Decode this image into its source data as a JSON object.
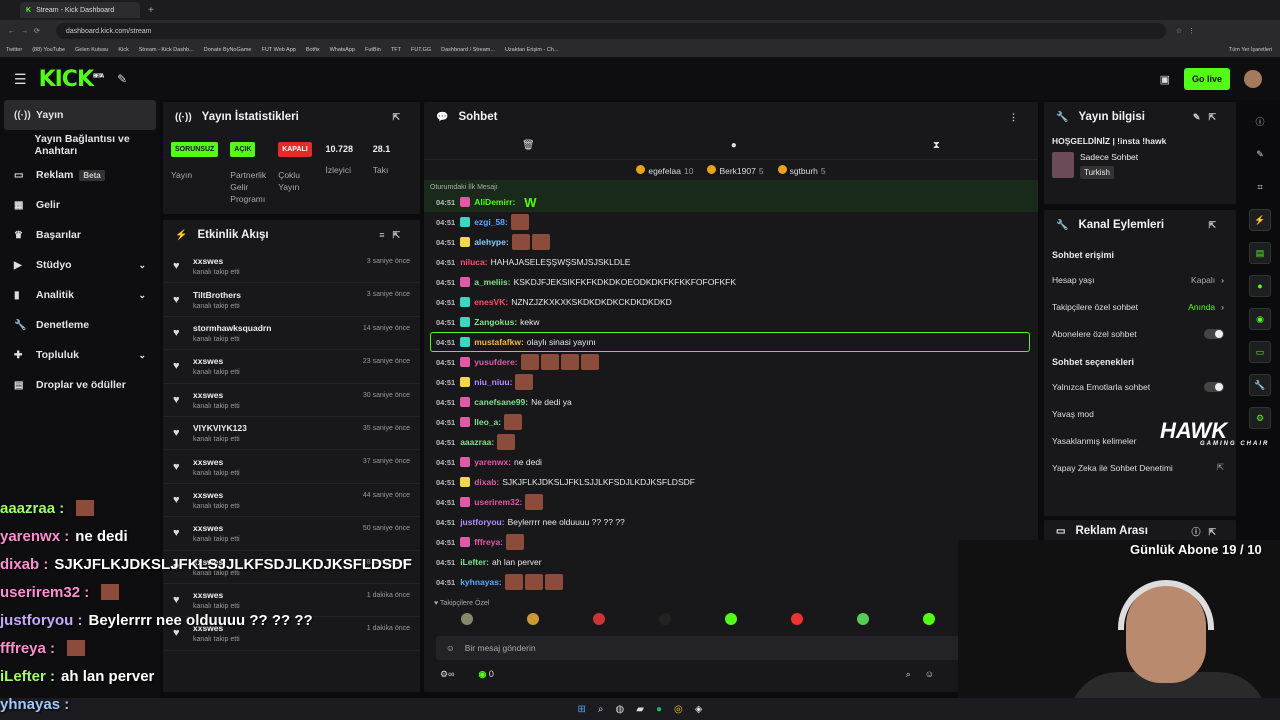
{
  "browser": {
    "tab_title": "Stream - Kick Dashboard",
    "url": "dashboard.kick.com/stream",
    "bookmarks": [
      "Twitter",
      "(88) YouTube",
      "Gelen Kutusu",
      "Kick",
      "Stream - Kick Dashb...",
      "Donate ByNoGame",
      "FUT Web App",
      "Botfix",
      "WhatsApp",
      "FutBin",
      "TFT",
      "FUT.GG",
      "Dashboard / Stream...",
      "Uzaktan Erişim - Ch..."
    ],
    "bookmarks_right": "Tüm Yer İşaretleri"
  },
  "header": {
    "logo": "KICK",
    "logo_sup": "BETA",
    "go_live": "Go live"
  },
  "sidebar": {
    "items": [
      {
        "label": "Yayın",
        "icon": "broadcast-icon"
      },
      {
        "label": "Yayın Bağlantısı ve Anahtarı",
        "icon": ""
      },
      {
        "label": "Reklam",
        "icon": "tv-icon",
        "badge": "Beta"
      },
      {
        "label": "Gelir",
        "icon": "grid-icon"
      },
      {
        "label": "Başarılar",
        "icon": "trophy-icon"
      },
      {
        "label": "Stüdyo",
        "icon": "video-icon"
      },
      {
        "label": "Analitik",
        "icon": "chart-icon"
      },
      {
        "label": "Denetleme",
        "icon": "wrench-icon"
      },
      {
        "label": "Topluluk",
        "icon": "community-icon"
      },
      {
        "label": "Droplar ve ödüller",
        "icon": "gift-icon"
      }
    ]
  },
  "stats": {
    "title": "Yayın İstatistikleri",
    "items": [
      {
        "badge": "SORUNSUZ",
        "label": "Yayın"
      },
      {
        "badge": "AÇIK",
        "label": "Partnerlik Gelir Programı"
      },
      {
        "badge": "KAPALI",
        "label": "Çoklu Yayın"
      },
      {
        "value": "10.728",
        "label": "İzleyici"
      },
      {
        "value": "28.1",
        "label": "Takı"
      }
    ]
  },
  "activity": {
    "title": "Etkinlik Akışı",
    "items": [
      {
        "name": "xxswes",
        "action": "kanalı takip etti",
        "time": "3 saniye önce"
      },
      {
        "name": "TiltBrothers",
        "action": "kanalı takip etti",
        "time": "3 saniye önce"
      },
      {
        "name": "stormhawksquadrn",
        "action": "kanalı takip etti",
        "time": "14 saniye önce"
      },
      {
        "name": "xxswes",
        "action": "kanalı takip etti",
        "time": "23 saniye önce"
      },
      {
        "name": "xxswes",
        "action": "kanalı takip etti",
        "time": "30 saniye önce"
      },
      {
        "name": "VIYKVIYK123",
        "action": "kanalı takip etti",
        "time": "35 saniye önce"
      },
      {
        "name": "xxswes",
        "action": "kanalı takip etti",
        "time": "37 saniye önce"
      },
      {
        "name": "xxswes",
        "action": "kanalı takip etti",
        "time": "44 saniye önce"
      },
      {
        "name": "xxswes",
        "action": "kanalı takip etti",
        "time": "50 saniye önce"
      },
      {
        "name": "xxswes",
        "action": "kanalı takip etti",
        "time": "58 saniye önce"
      },
      {
        "name": "xxswes",
        "action": "kanalı takip etti",
        "time": "1 dakika önce"
      },
      {
        "name": "xxswes",
        "action": "kanalı takip etti",
        "time": "1 dakika önce"
      }
    ]
  },
  "chat": {
    "title": "Sohbet",
    "gifters": [
      {
        "name": "egefelaa",
        "count": "10"
      },
      {
        "name": "Berk1907",
        "count": "5"
      },
      {
        "name": "sgtburh",
        "count": "5"
      }
    ],
    "pinned_label": "Oturumdaki İlk Mesajı",
    "messages": [
      {
        "time": "04:51",
        "user": "AliDemirr",
        "color": "#53fc18",
        "text": "",
        "badge": "#e05aa8",
        "emotes": 0,
        "w": true,
        "pinned": true
      },
      {
        "time": "04:51",
        "user": "ezgi_58",
        "color": "#5aa8ff",
        "text": "",
        "badge": "#3dd6c3",
        "emotes": 1
      },
      {
        "time": "04:51",
        "user": "alehype",
        "color": "#7fd0ff",
        "text": "",
        "badge": "#f2d64b",
        "emotes": 2
      },
      {
        "time": "04:51",
        "user": "niluca",
        "color": "#ff4f6a",
        "text": "HAHAJASELEŞŞWŞSMJSJSKLDLE",
        "badge": "",
        "emotes": 0
      },
      {
        "time": "04:51",
        "user": "a_meliis",
        "color": "#7fe08a",
        "text": "KSKDJFJEKSIKFKFKDKDKOEODKDKFKFKKFOFOFKFK",
        "badge": "#e05aa8",
        "emotes": 0
      },
      {
        "time": "04:51",
        "user": "enesVK",
        "color": "#ff4f6a",
        "text": "NZNZJZKXKXKSKDKDKDKCKDKDKDKD",
        "badge": "#3dd6c3",
        "emotes": 0
      },
      {
        "time": "04:51",
        "user": "Zangokus",
        "color": "#7fe08a",
        "text": "kekw",
        "badge": "#3dd6c3",
        "emotes": 0
      },
      {
        "time": "04:51",
        "user": "mustafafkw",
        "color": "#f2b84b",
        "text": "olaylı sinasi yayını",
        "badge": "#3dd6c3",
        "emotes": 0,
        "hl": true
      },
      {
        "time": "04:51",
        "user": "yusufdere",
        "color": "#e05aa8",
        "text": "",
        "badge": "#e05aa8",
        "emotes": 4
      },
      {
        "time": "04:51",
        "user": "niu_niuu",
        "color": "#b58bff",
        "text": "",
        "badge": "#f2d64b",
        "emotes": 1
      },
      {
        "time": "04:51",
        "user": "canefsane99",
        "color": "#7fe08a",
        "text": "Ne dedi ya",
        "badge": "#e05aa8",
        "emotes": 0
      },
      {
        "time": "04:51",
        "user": "lleo_a",
        "color": "#7fe08a",
        "text": "",
        "badge": "#e05aa8",
        "emotes": 1
      },
      {
        "time": "04:51",
        "user": "aaazraa",
        "color": "#7fe08a",
        "text": "",
        "badge": "",
        "emotes": 1
      },
      {
        "time": "04:51",
        "user": "yarenwx",
        "color": "#e05aa8",
        "text": "ne dedi",
        "badge": "#e05aa8",
        "emotes": 0
      },
      {
        "time": "04:51",
        "user": "dixab",
        "color": "#e05aa8",
        "text": "SJKJFLKJDKSLJFKLSJJLKFSDJLKDJKSFLDSDF",
        "badge": "#f2d64b",
        "emotes": 0
      },
      {
        "time": "04:51",
        "user": "userirem32",
        "color": "#e05aa8",
        "text": "",
        "badge": "#e05aa8",
        "emotes": 1
      },
      {
        "time": "04:51",
        "user": "justforyou",
        "color": "#b58bff",
        "text": "Beylerrrr nee olduuuu ?? ?? ??",
        "badge": "",
        "emotes": 0
      },
      {
        "time": "04:51",
        "user": "fffreya",
        "color": "#e05aa8",
        "text": "",
        "badge": "#e05aa8",
        "emotes": 1
      },
      {
        "time": "04:51",
        "user": "iLefter",
        "color": "#7fe08a",
        "text": "ah lan perver",
        "badge": "",
        "emotes": 0
      },
      {
        "time": "04:51",
        "user": "kyhnayas",
        "color": "#5aa8ff",
        "text": "",
        "badge": "",
        "emotes": 3
      }
    ],
    "follower_label": "Takipçilere Özel",
    "input_placeholder": "Bir mesaj gönderin",
    "points": "0"
  },
  "stream_info": {
    "title": "Yayın bilgisi",
    "stream_title": "HOŞGELDİNİZ | !insta !hawk",
    "category": "Sadece Sohbet",
    "language": "Turkish"
  },
  "channel_actions": {
    "title": "Kanal Eylemleri",
    "chat_access": "Sohbet erişimi",
    "account_age": {
      "label": "Hesap yaşı",
      "value": "Kapalı"
    },
    "follower_chat": {
      "label": "Takipçilere özel sohbet",
      "value": "Anında"
    },
    "sub_chat": {
      "label": "Abonelere özel sohbet"
    },
    "chat_options": "Sohbet seçenekleri",
    "emote_only": {
      "label": "Yalnızca Emotlarla sohbet"
    },
    "slow_mode": {
      "label": "Yavaş mod"
    },
    "banned_words": {
      "label": "Yasaklanmış kelimeler"
    },
    "ai_moderation": {
      "label": "Yapay Zeka ile Sohbet Denetimi"
    }
  },
  "ad_break": {
    "title": "Reklam Arası"
  },
  "overlay": {
    "lines": [
      {
        "user": "aaazraa :",
        "text": "",
        "emote": true,
        "color": "#9eff6a"
      },
      {
        "user": "yarenwx :",
        "text": "ne dedi",
        "emote": false,
        "color": "#ff8fd2"
      },
      {
        "user": "dixab :",
        "text": "SJKJFLKJDKSLJFKLSJJLKFSDJLKDJKSFLDSDF",
        "emote": false,
        "color": "#ff8fd2"
      },
      {
        "user": "userirem32 :",
        "text": "",
        "emote": true,
        "color": "#ff8fd2"
      },
      {
        "user": "justforyou :",
        "text": "Beylerrrr nee olduuuu ?? ?? ??",
        "emote": false,
        "color": "#c9a8ff"
      },
      {
        "user": "fffreya :",
        "text": "",
        "emote": true,
        "color": "#ff8fd2"
      },
      {
        "user": "iLefter :",
        "text": "ah lan perver",
        "emote": false,
        "color": "#9eff6a"
      }
    ],
    "bottom_user": "yhnayas :",
    "hawk": "HAWK",
    "hawk_sub": "GAMING CHAIR",
    "sub_goal": "Günlük Abone 19 / 10"
  }
}
